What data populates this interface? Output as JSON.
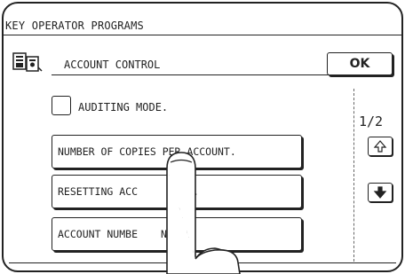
{
  "window": {
    "title": "KEY OPERATOR PROGRAMS"
  },
  "header": {
    "label": "ACCOUNT CONTROL",
    "ok_label": "OK",
    "icon": "account-control-icon"
  },
  "auditing": {
    "label": "AUDITING MODE.",
    "checked": false
  },
  "menu": {
    "items": [
      {
        "label": "NUMBER OF COPIES PER ACCOUNT."
      },
      {
        "label": "RESETTING ACC"
      },
      {
        "label": "ACCOUNT NUMBE"
      }
    ],
    "item2_tail": ".",
    "item3_tail": "NTROL."
  },
  "pager": {
    "indicator": "1/2",
    "up_icon": "arrow-up-icon",
    "down_icon": "arrow-down-icon"
  },
  "overlay": {
    "icon": "pointing-hand-icon"
  }
}
